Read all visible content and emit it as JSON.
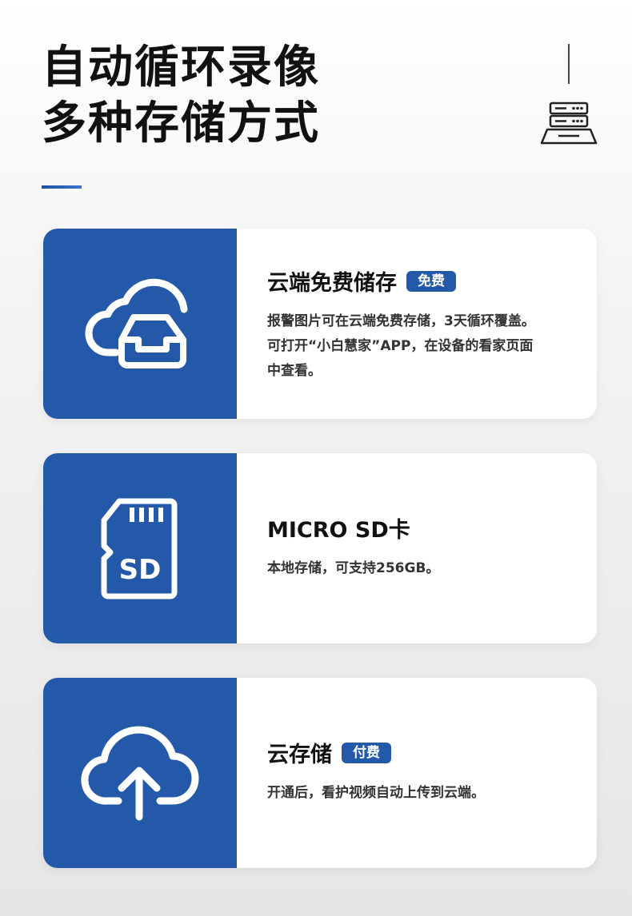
{
  "headline": {
    "line1": "自动循环录像",
    "line2": "多种存储方式"
  },
  "cards": [
    {
      "title": "云端免费储存",
      "badge": "免费",
      "icon": "cloud-storage-icon",
      "description": [
        "报警图片可在云端免费存储，3天循环覆盖。",
        "可打开“小白慧家”APP，在设备的看家页面",
        "中查看。"
      ]
    },
    {
      "title": "MICRO SD卡",
      "icon": "sd-card-icon",
      "icon_label": "SD",
      "description": [
        "本地存储，可支持256GB。"
      ]
    },
    {
      "title": "云存储",
      "badge": "付费",
      "icon": "cloud-upload-icon",
      "description": [
        "开通后，看护视频自动上传到云端。"
      ]
    }
  ],
  "colors": {
    "accent": "#2359a8",
    "text": "#111111"
  }
}
